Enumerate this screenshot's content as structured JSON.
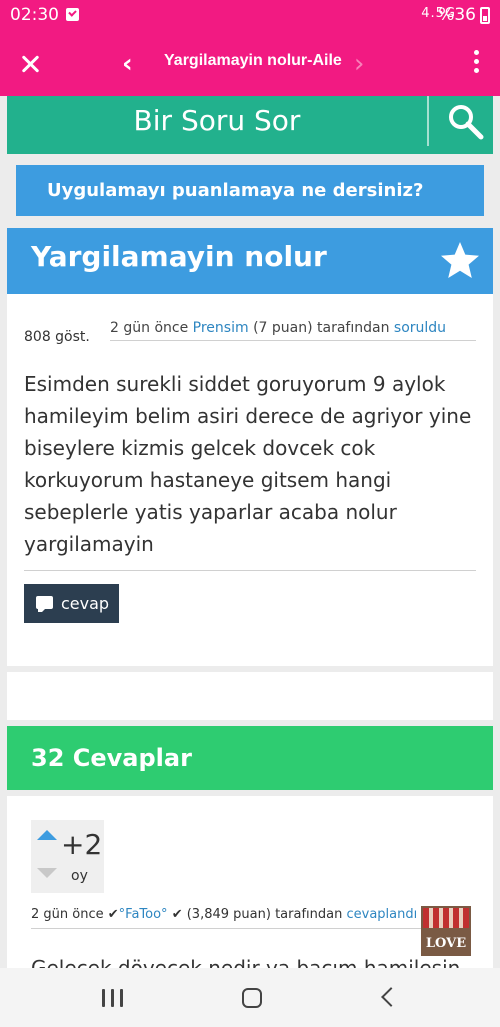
{
  "status_bar": {
    "time": "02:30",
    "system_indicators": "4.5G",
    "battery": "%36"
  },
  "app_bar": {
    "title": "Yargilamayin nolur-Aile",
    "back_glyph": "‹",
    "forward_glyph": "›"
  },
  "ask_bar": {
    "label": "Bir Soru Sor"
  },
  "rate_banner": {
    "text": "Uygulamayı puanlamaya ne dersiniz?"
  },
  "question": {
    "title": "Yargilamayin nolur",
    "views": "808 göst.",
    "meta_time": "2 gün önce",
    "author": "Prensim",
    "author_points": "(7 puan)",
    "meta_by": "tarafından",
    "meta_action": "soruldu",
    "body": "Esimden surekli siddet goruyorum 9 aylok hamileyim belim asiri derece de agriyor yine biseylere kizmis gelcek dovcek cok korkuyorum hastaneye gitsem hangi sebeplerle yatis yaparlar acaba nolur yargilamayin",
    "answer_button": "cevap"
  },
  "answers_header": {
    "text": "32 Cevaplar"
  },
  "answer": {
    "score": "+2",
    "score_unit": "oy",
    "meta_time": "2 gün önce",
    "author": "°FaToo°",
    "author_points": "(3,849 puan)",
    "meta_by": "tarafından",
    "meta_action": "cevaplandı",
    "avatar_text": "LOVE",
    "body_preview": "Gelecek dövecek nedir ya bacım hamilesin"
  },
  "colors": {
    "brand": "#f21a82",
    "ask_green": "#22b18d",
    "primary_blue": "#3d9ce0",
    "answers_green": "#2ecc71",
    "link": "#2e86c1"
  },
  "icons": [
    "close-icon",
    "back-icon",
    "forward-icon",
    "more-vert-icon",
    "search-icon",
    "star-icon",
    "comment-icon",
    "vote-up-icon",
    "vote-down-icon",
    "recents-icon",
    "home-icon",
    "nav-back-icon"
  ]
}
